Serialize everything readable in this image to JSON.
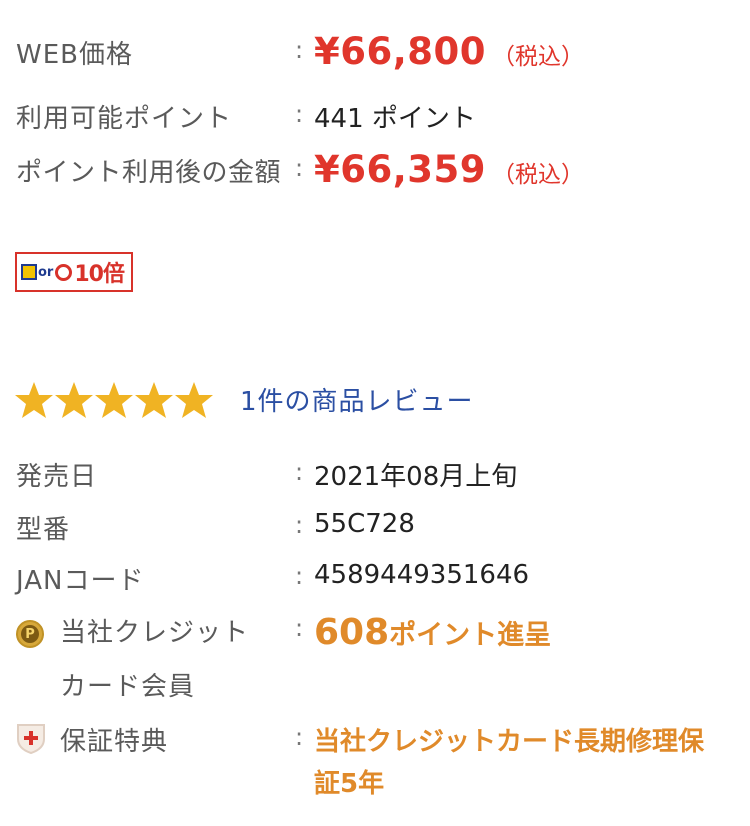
{
  "price_block": {
    "web_price_label": "WEB価格",
    "web_price": "¥66,800",
    "tax_label": "（税込）",
    "points_label": "利用可能ポイント",
    "points_value": "441 ポイント",
    "after_points_label": "ポイント利用後の金額",
    "after_points_price": "¥66,359",
    "after_points_tax": "（税込）",
    "colon": ":"
  },
  "badge": {
    "or_text": "or",
    "multiplier": "10倍"
  },
  "review": {
    "rating": 5,
    "max_rating": 5,
    "link_text": "1件の商品レビュー"
  },
  "details": {
    "release_label": "発売日",
    "release_value": "2021年08月上旬",
    "model_label": "型番",
    "model_value": "55C728",
    "jan_label": "JANコード",
    "jan_value": "4589449351646",
    "credit_label_1": "当社クレジット",
    "credit_label_2": "カード会員",
    "credit_points": "608",
    "credit_points_suffix": "ポイント進呈",
    "warranty_label": "保証特典",
    "warranty_line_1": "当社クレジットカード長期修理保",
    "warranty_line_2": "証5年",
    "icon_p_letter": "P"
  },
  "colors": {
    "price_red": "#e0362c",
    "link_blue": "#2b4fa3",
    "accent_orange": "#e08a2a",
    "star_gold": "#f0b323"
  }
}
